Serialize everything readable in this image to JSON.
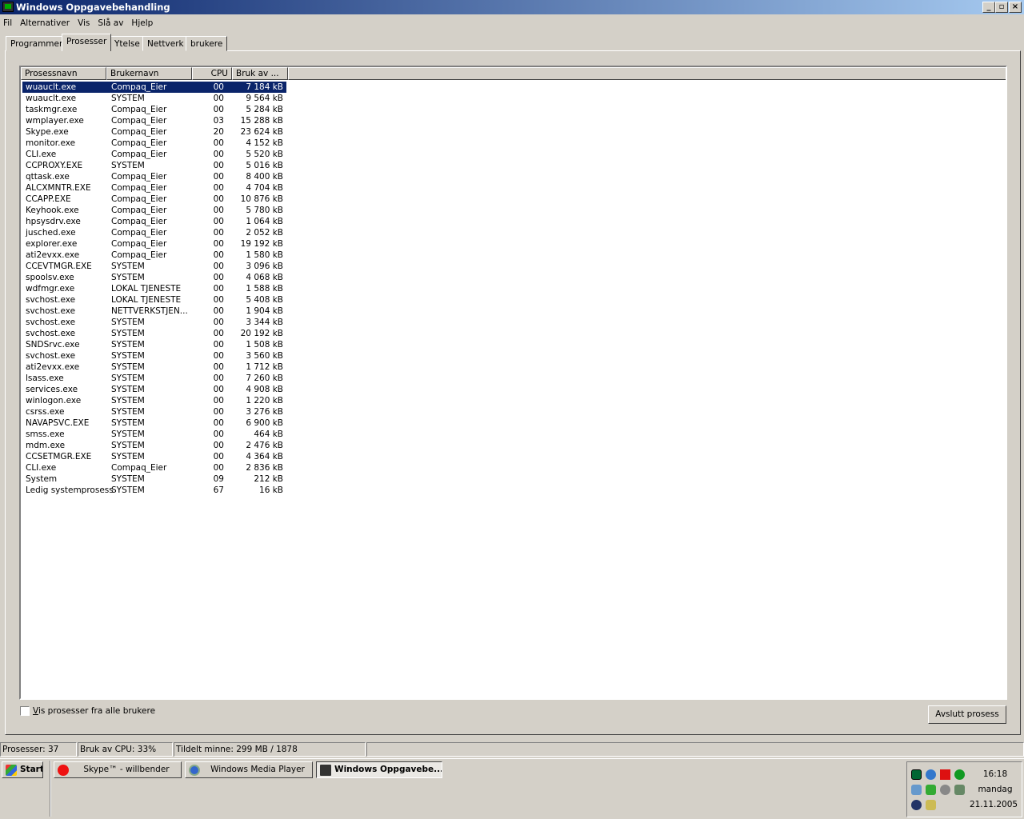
{
  "window": {
    "title": "Windows Oppgavebehandling"
  },
  "menu": [
    "Fil",
    "Alternativer",
    "Vis",
    "Slå av",
    "Hjelp"
  ],
  "tabs": [
    "Programmer",
    "Prosesser",
    "Ytelse",
    "Nettverk",
    "brukere"
  ],
  "active_tab": "Prosesser",
  "columns": [
    "Prosessnavn",
    "Brukernavn",
    "CPU",
    "Bruk av ..."
  ],
  "rows": [
    [
      "wuauclt.exe",
      "Compaq_Eier",
      "00",
      "7 184 kB"
    ],
    [
      "wuauclt.exe",
      "SYSTEM",
      "00",
      "9 564 kB"
    ],
    [
      "taskmgr.exe",
      "Compaq_Eier",
      "00",
      "5 284 kB"
    ],
    [
      "wmplayer.exe",
      "Compaq_Eier",
      "03",
      "15 288 kB"
    ],
    [
      "Skype.exe",
      "Compaq_Eier",
      "20",
      "23 624 kB"
    ],
    [
      "monitor.exe",
      "Compaq_Eier",
      "00",
      "4 152 kB"
    ],
    [
      "CLI.exe",
      "Compaq_Eier",
      "00",
      "5 520 kB"
    ],
    [
      "CCPROXY.EXE",
      "SYSTEM",
      "00",
      "5 016 kB"
    ],
    [
      "qttask.exe",
      "Compaq_Eier",
      "00",
      "8 400 kB"
    ],
    [
      "ALCXMNTR.EXE",
      "Compaq_Eier",
      "00",
      "4 704 kB"
    ],
    [
      "CCAPP.EXE",
      "Compaq_Eier",
      "00",
      "10 876 kB"
    ],
    [
      "Keyhook.exe",
      "Compaq_Eier",
      "00",
      "5 780 kB"
    ],
    [
      "hpsysdrv.exe",
      "Compaq_Eier",
      "00",
      "1 064 kB"
    ],
    [
      "jusched.exe",
      "Compaq_Eier",
      "00",
      "2 052 kB"
    ],
    [
      "explorer.exe",
      "Compaq_Eier",
      "00",
      "19 192 kB"
    ],
    [
      "ati2evxx.exe",
      "Compaq_Eier",
      "00",
      "1 580 kB"
    ],
    [
      "CCEVTMGR.EXE",
      "SYSTEM",
      "00",
      "3 096 kB"
    ],
    [
      "spoolsv.exe",
      "SYSTEM",
      "00",
      "4 068 kB"
    ],
    [
      "wdfmgr.exe",
      "LOKAL TJENESTE",
      "00",
      "1 588 kB"
    ],
    [
      "svchost.exe",
      "LOKAL TJENESTE",
      "00",
      "5 408 kB"
    ],
    [
      "svchost.exe",
      "NETTVERKSTJEN...",
      "00",
      "1 904 kB"
    ],
    [
      "svchost.exe",
      "SYSTEM",
      "00",
      "3 344 kB"
    ],
    [
      "svchost.exe",
      "SYSTEM",
      "00",
      "20 192 kB"
    ],
    [
      "SNDSrvc.exe",
      "SYSTEM",
      "00",
      "1 508 kB"
    ],
    [
      "svchost.exe",
      "SYSTEM",
      "00",
      "3 560 kB"
    ],
    [
      "ati2evxx.exe",
      "SYSTEM",
      "00",
      "1 712 kB"
    ],
    [
      "lsass.exe",
      "SYSTEM",
      "00",
      "7 260 kB"
    ],
    [
      "services.exe",
      "SYSTEM",
      "00",
      "4 908 kB"
    ],
    [
      "winlogon.exe",
      "SYSTEM",
      "00",
      "1 220 kB"
    ],
    [
      "csrss.exe",
      "SYSTEM",
      "00",
      "3 276 kB"
    ],
    [
      "NAVAPSVC.EXE",
      "SYSTEM",
      "00",
      "6 900 kB"
    ],
    [
      "smss.exe",
      "SYSTEM",
      "00",
      "464 kB"
    ],
    [
      "mdm.exe",
      "SYSTEM",
      "00",
      "2 476 kB"
    ],
    [
      "CCSETMGR.EXE",
      "SYSTEM",
      "00",
      "4 364 kB"
    ],
    [
      "CLI.exe",
      "Compaq_Eier",
      "00",
      "2 836 kB"
    ],
    [
      "System",
      "SYSTEM",
      "09",
      "212 kB"
    ],
    [
      "Ledig systemprosess",
      "SYSTEM",
      "67",
      "16 kB"
    ]
  ],
  "show_all_users": {
    "label": "Vis prosesser fra alle brukere",
    "checked": false
  },
  "end_process": "Avslutt prosess",
  "status": {
    "processes": "Prosesser: 37",
    "cpu": "Bruk av CPU: 33%",
    "memory": "Tildelt minne: 299 MB / 1878"
  },
  "taskbar": {
    "start": "Start",
    "buttons": [
      "Skype™ - willbender",
      "Windows Media Player",
      "Windows Oppgavebe..."
    ]
  },
  "clock": {
    "time": "16:18",
    "day": "mandag",
    "date": "21.11.2005"
  },
  "tray_icons": [
    "cpu-meter-icon",
    "network-globe-icon",
    "ati-icon",
    "globe-icon",
    "network-computers-icon",
    "phone-icon",
    "speaker-icon",
    "update-icon",
    "search-icon",
    "security-icon"
  ]
}
